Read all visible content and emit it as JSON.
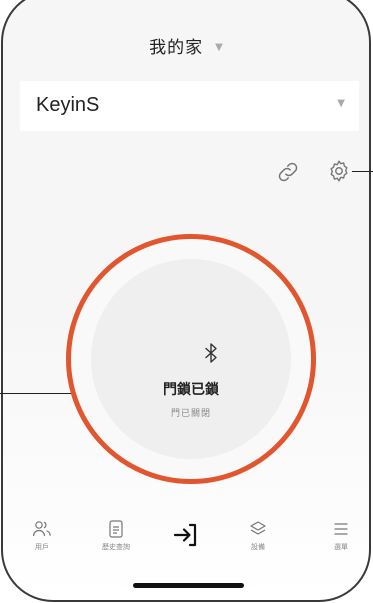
{
  "header": {
    "home_name": "我的家"
  },
  "lock_selector": {
    "value": "KeyinS"
  },
  "lock_status": {
    "title": "門鎖已鎖",
    "subtitle": "門已關閉"
  },
  "tabbar": {
    "items": [
      {
        "label": "用戶",
        "icon": "users-icon"
      },
      {
        "label": "歷史查詢",
        "icon": "history-icon"
      },
      {
        "label": "",
        "icon": "unlock-arrow-icon"
      },
      {
        "label": "設備",
        "icon": "layers-icon"
      },
      {
        "label": "選單",
        "icon": "menu-icon"
      }
    ]
  },
  "colors": {
    "accent": "#e2562f",
    "background": "#f6f6f6"
  }
}
